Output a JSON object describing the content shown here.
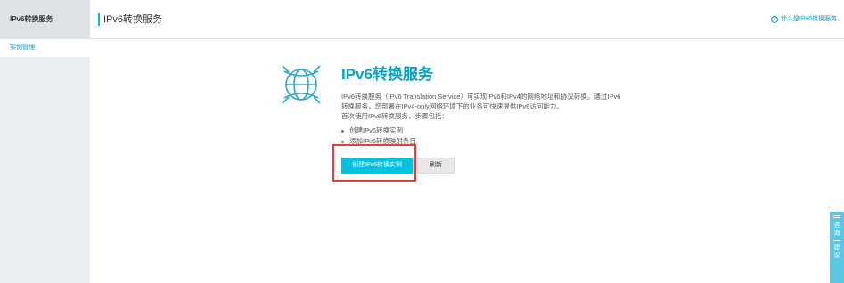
{
  "sidebar": {
    "title": "IPv6转换服务",
    "items": [
      {
        "label": "实例管理"
      }
    ]
  },
  "header": {
    "title": "IPv6转换服务",
    "help_link": "什么是IPv6转换服务"
  },
  "intro": {
    "title": "IPv6转换服务",
    "description": "IPv6转换服务（IPv6 Translation Service）可实现IPv6和IPv4的网络地址和协议转换。通过IPv6转换服务，您部署在IPv4-only网络环境下的业务可快速提供IPv6访问能力。",
    "steps_intro": "首次使用IPv6转换服务，步骤包括：",
    "steps": [
      "创建IPv6转换实例",
      "添加IPv6转换映射条目"
    ]
  },
  "buttons": {
    "create": "创建IPv6转换实例",
    "refresh": "刷新"
  },
  "float_tab": {
    "label_top": "咨询",
    "label_bottom": "建议"
  },
  "colors": {
    "accent": "#00c1de",
    "link": "#00a2ca",
    "highlight_border": "#e0413a",
    "sidebar_bg": "#eaedf1"
  }
}
